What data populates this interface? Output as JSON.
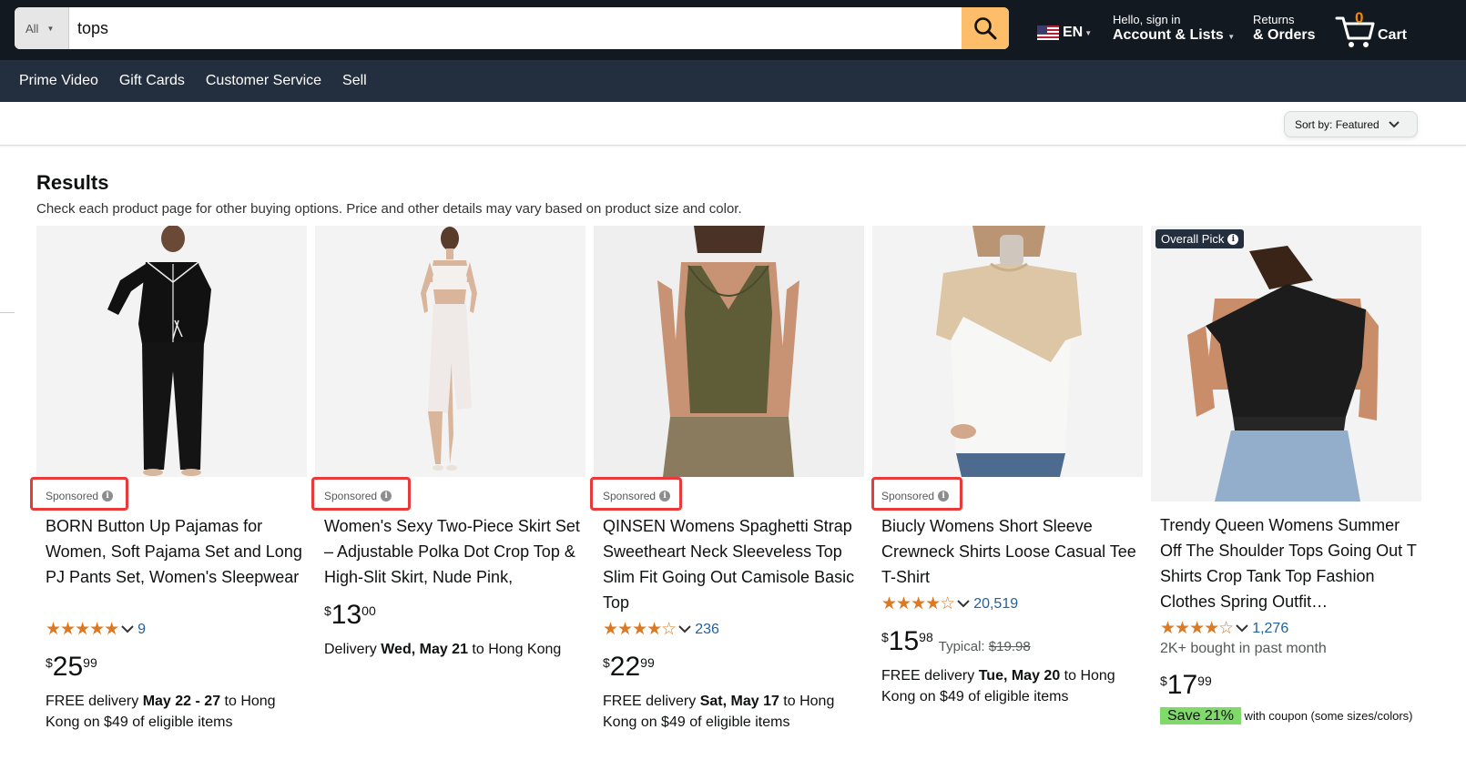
{
  "header": {
    "search": {
      "category": "All",
      "value": "tops"
    },
    "language": "EN",
    "account": {
      "greeting": "Hello, sign in",
      "label": "Account & Lists"
    },
    "orders": {
      "top": "Returns",
      "bottom": "& Orders"
    },
    "cart": {
      "count": "0",
      "label": "Cart"
    }
  },
  "nav": {
    "items": [
      "Prime Video",
      "Gift Cards",
      "Customer Service",
      "Sell"
    ]
  },
  "sort": {
    "label": "Sort by:",
    "value": "Featured"
  },
  "results": {
    "title": "Results",
    "subtitle": "Check each product page for other buying options. Price and other details may vary based on product size and color."
  },
  "products": [
    {
      "sponsored": "Sponsored",
      "title": "BORN Button Up Pajamas for Women, Soft Pajama Set and Long PJ Pants Set, Women's Sleepwear",
      "stars": "★★★★★",
      "rating_count": "9",
      "rating_value": 5.0,
      "price": {
        "symbol": "$",
        "whole": "25",
        "fraction": "99"
      },
      "delivery_prefix": "FREE delivery ",
      "delivery_date": "May 22 - 27",
      "delivery_suffix": " to Hong Kong on $49 of eligible items"
    },
    {
      "sponsored": "Sponsored",
      "title": "Women's Sexy Two-Piece Skirt Set – Adjustable Polka Dot Crop Top & High-Slit Skirt, Nude Pink,",
      "price": {
        "symbol": "$",
        "whole": "13",
        "fraction": "00"
      },
      "delivery_prefix": "Delivery ",
      "delivery_date": "Wed, May 21",
      "delivery_suffix": " to Hong Kong"
    },
    {
      "sponsored": "Sponsored",
      "title": "QINSEN Womens Spaghetti Strap Sweetheart Neck Sleeveless Top Slim Fit Going Out Camisole Basic Top",
      "stars": "★★★★",
      "stars_empty": "☆",
      "rating_count": "236",
      "rating_value": 4.5,
      "price": {
        "symbol": "$",
        "whole": "22",
        "fraction": "99"
      },
      "delivery_prefix": "FREE delivery ",
      "delivery_date": "Sat, May 17",
      "delivery_suffix": " to Hong Kong on $49 of eligible items"
    },
    {
      "sponsored": "Sponsored",
      "title": "Biucly Womens Short Sleeve Crewneck Shirts Loose Casual Tee T-Shirt",
      "stars": "★★★★",
      "stars_empty": "☆",
      "rating_count": "20,519",
      "rating_value": 4.0,
      "price": {
        "symbol": "$",
        "whole": "15",
        "fraction": "98"
      },
      "typical_label": "Typical: ",
      "typical_price": "$19.98",
      "delivery_prefix": "FREE delivery ",
      "delivery_date": "Tue, May 20",
      "delivery_suffix": " to Hong Kong on $49 of eligible items"
    },
    {
      "badge": "Overall Pick",
      "title": "Trendy Queen Womens Summer Off The Shoulder Tops Going Out T Shirts Crop Tank Top Fashion Clothes Spring Outfit…",
      "stars": "★★★★",
      "stars_empty": "☆",
      "rating_count": "1,276",
      "rating_value": 4.5,
      "bought": "2K+ bought in past month",
      "price": {
        "symbol": "$",
        "whole": "17",
        "fraction": "99"
      },
      "coupon_badge": "Save 21%",
      "coupon_text": " with coupon (some sizes/colors)"
    }
  ],
  "colors": {
    "header": "#131921",
    "nav": "#232f3e",
    "search_button": "#febd69",
    "star": "#de7921",
    "link": "#2162a1",
    "highlight": "#e83a3a"
  }
}
